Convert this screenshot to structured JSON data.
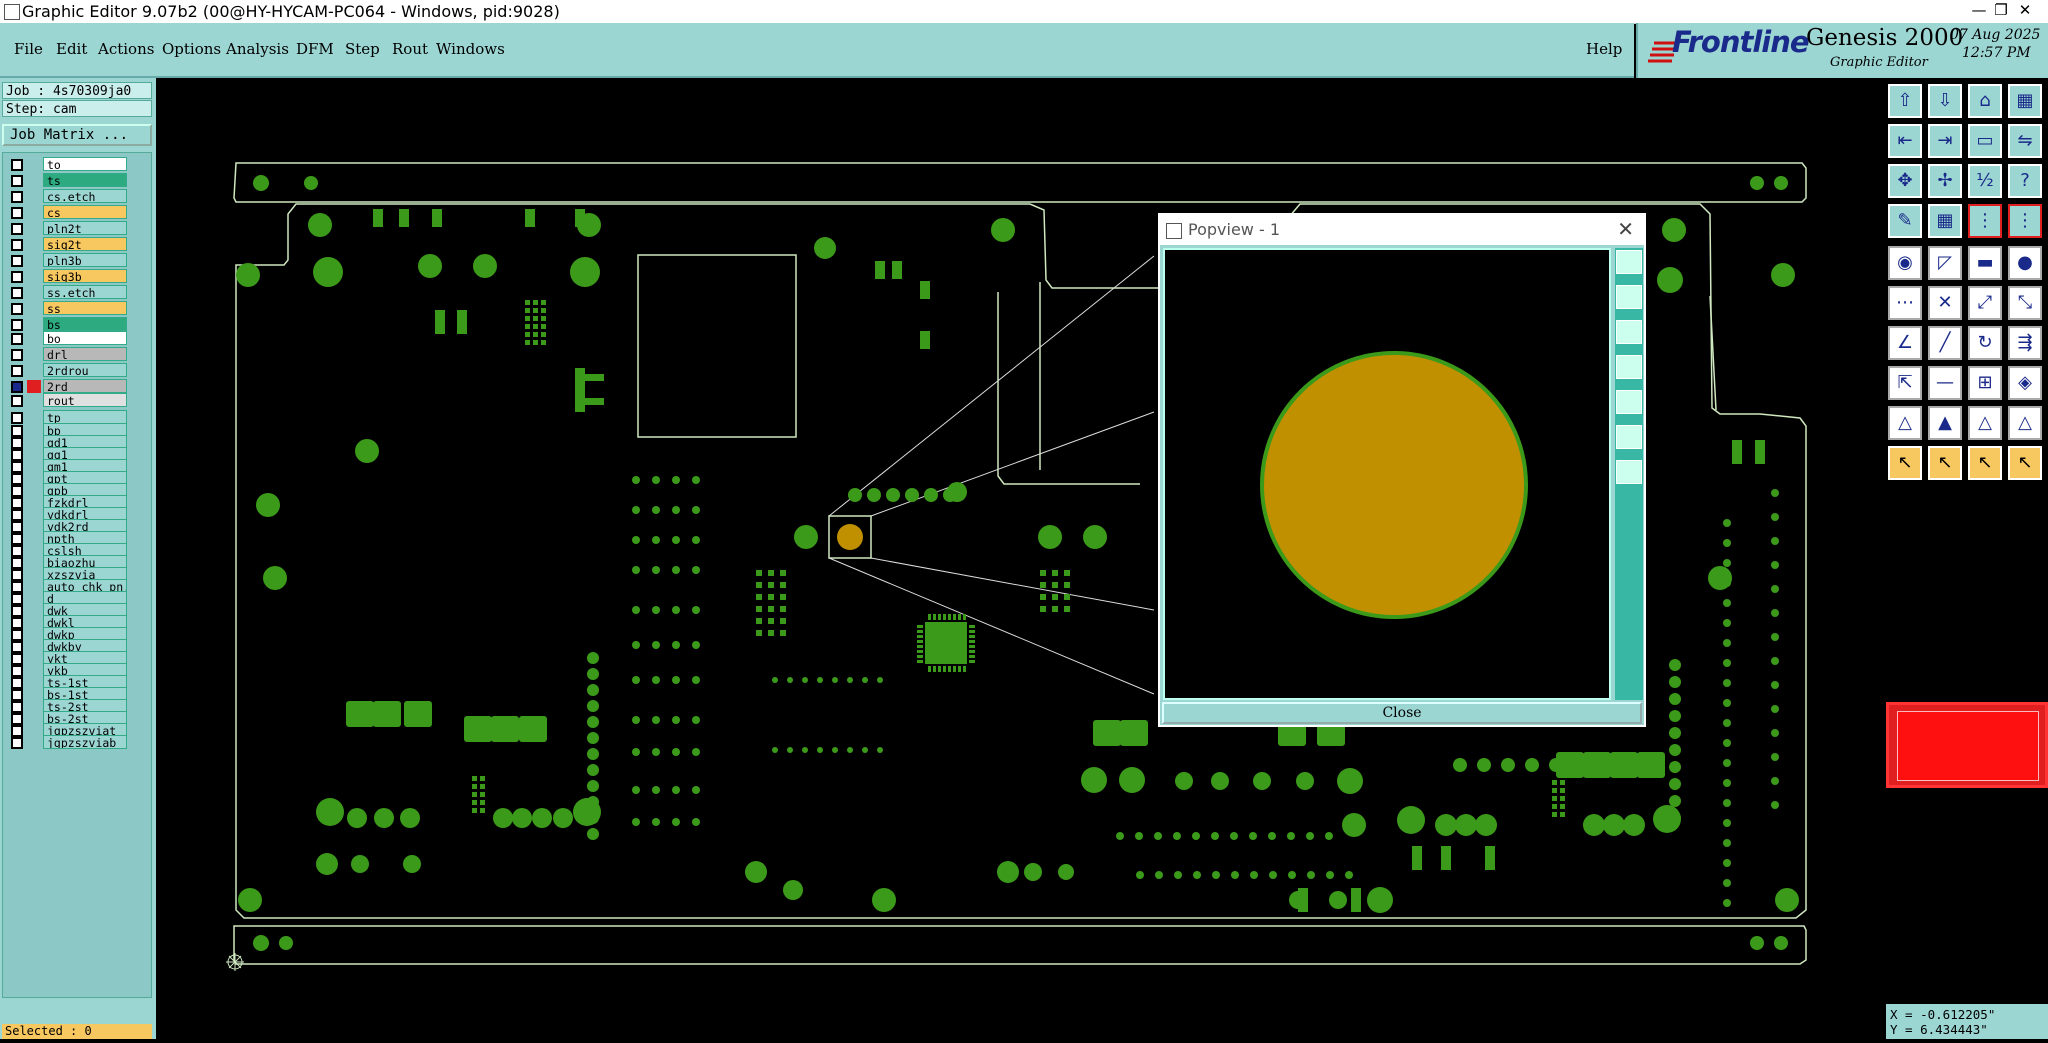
{
  "window": {
    "title": "Graphic Editor 9.07b2 (00@HY-HYCAM-PC064 - Windows, pid:9028)",
    "controls": [
      "—",
      "❐",
      "✕"
    ]
  },
  "menu": {
    "items": [
      "File",
      "Edit",
      "Actions",
      "Options",
      "Analysis",
      "DFM",
      "Step",
      "Rout",
      "Windows"
    ],
    "help": "Help"
  },
  "brand": {
    "logo": "Frontline",
    "product": "Genesis 2000",
    "subtitle": "Graphic Editor",
    "date": "07 Aug 2025",
    "time": "12:57 PM"
  },
  "job": {
    "job_label": "Job : 4s70309ja0",
    "step_label": "Step: cam",
    "matrix_button": "Job Matrix ..."
  },
  "layers": [
    {
      "name": "to",
      "color": "#ffffff",
      "bg": "#ffffff"
    },
    {
      "name": "ts",
      "color": "#2eaa80",
      "bg": "#2eaa80"
    },
    {
      "name": "cs.etch",
      "color": "#9cd6d3",
      "bg": "#9cd6d3"
    },
    {
      "name": "cs",
      "color": "#f8c860",
      "bg": "#f8c860"
    },
    {
      "name": "pln2t",
      "color": "#9cd6d3",
      "bg": "#9cd6d3"
    },
    {
      "name": "sig2t",
      "color": "#f8c860",
      "bg": "#f8c860"
    },
    {
      "name": "pln3b",
      "color": "#9cd6d3",
      "bg": "#9cd6d3"
    },
    {
      "name": "sig3b",
      "color": "#f8c860",
      "bg": "#f8c860"
    },
    {
      "name": "ss.etch",
      "color": "#9cd6d3",
      "bg": "#9cd6d3"
    },
    {
      "name": "ss",
      "color": "#f8c860",
      "bg": "#f8c860"
    },
    {
      "name": "bs",
      "color": "#2eaa80",
      "bg": "#2eaa80"
    },
    {
      "name": "bo",
      "color": "#ffffff",
      "bg": "#ffffff"
    },
    {
      "name": "drl",
      "color": "#b8b8b8",
      "bg": "#b8b8b8"
    },
    {
      "name": "2rdrou",
      "color": "#9cd6d3",
      "bg": "#9cd6d3"
    },
    {
      "name": "2rd",
      "color": "#e02020",
      "bg": "#b8b8b8"
    },
    {
      "name": "rout",
      "color": "#e0e0e0",
      "bg": "#e0e0e0"
    },
    {
      "name": "tp",
      "color": "#9cd6d3",
      "bg": "#9cd6d3"
    },
    {
      "name": "bp",
      "color": "#9cd6d3",
      "bg": "#9cd6d3"
    },
    {
      "name": "gd1",
      "color": "#9cd6d3",
      "bg": "#9cd6d3"
    },
    {
      "name": "gg1",
      "color": "#9cd6d3",
      "bg": "#9cd6d3"
    },
    {
      "name": "gm1",
      "color": "#9cd6d3",
      "bg": "#9cd6d3"
    },
    {
      "name": "gpt",
      "color": "#9cd6d3",
      "bg": "#9cd6d3"
    },
    {
      "name": "gpb",
      "color": "#9cd6d3",
      "bg": "#9cd6d3"
    },
    {
      "name": "fzkdrl",
      "color": "#9cd6d3",
      "bg": "#9cd6d3"
    },
    {
      "name": "ydkdrl",
      "color": "#9cd6d3",
      "bg": "#9cd6d3"
    },
    {
      "name": "ydk2rd",
      "color": "#9cd6d3",
      "bg": "#9cd6d3"
    },
    {
      "name": "npth",
      "color": "#9cd6d3",
      "bg": "#9cd6d3"
    },
    {
      "name": "cslsh",
      "color": "#9cd6d3",
      "bg": "#9cd6d3"
    },
    {
      "name": "biaozhu",
      "color": "#9cd6d3",
      "bg": "#9cd6d3"
    },
    {
      "name": "xzszvia",
      "color": "#9cd6d3",
      "bg": "#9cd6d3"
    },
    {
      "name": "auto_chk_pn.",
      "color": "#9cd6d3",
      "bg": "#9cd6d3"
    },
    {
      "name": "d",
      "color": "#9cd6d3",
      "bg": "#9cd6d3"
    },
    {
      "name": "dwk",
      "color": "#9cd6d3",
      "bg": "#9cd6d3"
    },
    {
      "name": "dwkl",
      "color": "#9cd6d3",
      "bg": "#9cd6d3"
    },
    {
      "name": "dwkp",
      "color": "#9cd6d3",
      "bg": "#9cd6d3"
    },
    {
      "name": "dwkby",
      "color": "#9cd6d3",
      "bg": "#9cd6d3"
    },
    {
      "name": "ykt",
      "color": "#9cd6d3",
      "bg": "#9cd6d3"
    },
    {
      "name": "ykb",
      "color": "#9cd6d3",
      "bg": "#9cd6d3"
    },
    {
      "name": "ts-1st",
      "color": "#9cd6d3",
      "bg": "#9cd6d3"
    },
    {
      "name": "bs-1st",
      "color": "#9cd6d3",
      "bg": "#9cd6d3"
    },
    {
      "name": "ts-2st",
      "color": "#9cd6d3",
      "bg": "#9cd6d3"
    },
    {
      "name": "bs-2st",
      "color": "#9cd6d3",
      "bg": "#9cd6d3"
    },
    {
      "name": "jgpzszviat",
      "color": "#9cd6d3",
      "bg": "#9cd6d3"
    },
    {
      "name": "jgpzszviab",
      "color": "#9cd6d3",
      "bg": "#9cd6d3"
    }
  ],
  "status": {
    "selected": "Selected : 0",
    "x": "X = -0.612205\"",
    "y": "Y = 6.434443\""
  },
  "popview": {
    "title": "Popview - 1",
    "close_x": "✕",
    "close_button": "Close"
  },
  "colors": {
    "board_feature": "#3c9a1a",
    "highlighted_pad": "#c09000",
    "panel_bg": "#9cd6d3",
    "selected_layer": "#e02020"
  },
  "toolbar_icons": [
    "open-job-icon",
    "save-job-icon",
    "home-icon",
    "layout-icon",
    "import-icon",
    "export-icon",
    "window-icon",
    "stretch-icon",
    "zoom-fit-icon",
    "zoom-center-icon",
    "scale-icon",
    "help-icon",
    "measure-icon",
    "grid-icon",
    "snap-icon",
    "snap-alt-icon",
    "pad-icon",
    "line-icon",
    "ruler-icon",
    "circle-icon",
    "nodes-icon",
    "cross-icon",
    "connect-icon",
    "route-icon",
    "angle-icon",
    "diagonal-icon",
    "rotate-icon",
    "align-icon",
    "copy-icon",
    "minus-icon",
    "frame-icon",
    "group-icon",
    "arrow-up-icon",
    "arrow-up-bold-icon",
    "arrow-frame-icon",
    "arrow-wide-icon",
    "select-icon",
    "select-alt-icon",
    "select-frame-icon",
    "select-multi-icon"
  ]
}
